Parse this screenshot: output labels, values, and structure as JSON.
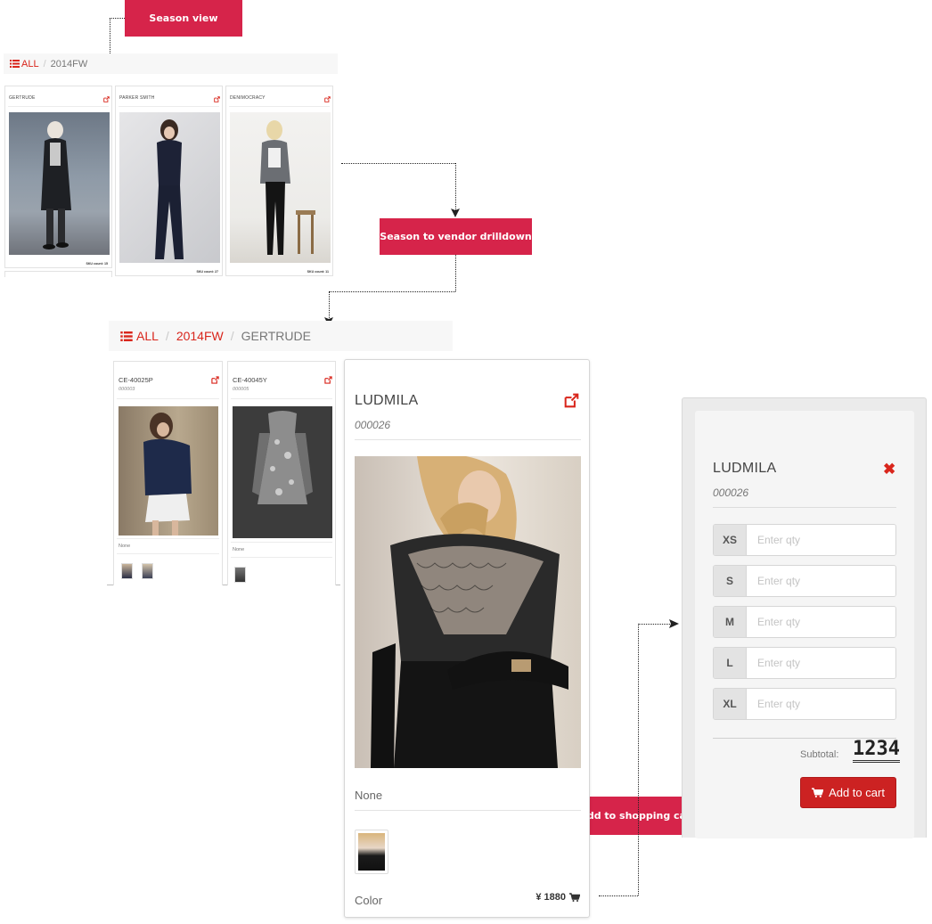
{
  "callouts": {
    "season_view": "Season view",
    "season_to_vendor": "Season to vendor drilldown",
    "add_to_cart": "Add to shopping cart"
  },
  "season_view": {
    "breadcrumb": {
      "all": "ALL",
      "separator": "/",
      "current": "2014FW"
    },
    "cards": [
      {
        "name": "GERTRUDE",
        "sku": "SKU count: 15"
      },
      {
        "name": "PARKER SMITH",
        "sku": "SKU count: 27"
      },
      {
        "name": "DENIMOCRACY",
        "sku": "SKU count: 11"
      }
    ]
  },
  "vendor_view": {
    "breadcrumb": {
      "all": "ALL",
      "separator": "/",
      "season": "2014FW",
      "current": "GERTRUDE"
    },
    "cards": [
      {
        "code": "CE-40025P",
        "id": "000003",
        "desc": "None"
      },
      {
        "code": "CE-40045Y",
        "id": "000005",
        "desc": "None"
      }
    ]
  },
  "product": {
    "name": "LUDMILA",
    "id": "000026",
    "description": "None",
    "color_label": "Color",
    "price": "¥ 1880"
  },
  "cart": {
    "name": "LUDMILA",
    "id": "000026",
    "placeholder": "Enter qty",
    "sizes": [
      "XS",
      "S",
      "M",
      "L",
      "XL"
    ],
    "subtotal_label": "Subtotal:",
    "subtotal_value": "1234",
    "add_button": "Add to cart"
  },
  "colors": {
    "accent": "#d9261c",
    "callout": "#d6244a"
  },
  "icons": [
    "list-icon",
    "external-link-icon",
    "tag-icon",
    "shopping-cart-icon",
    "close-icon"
  ]
}
